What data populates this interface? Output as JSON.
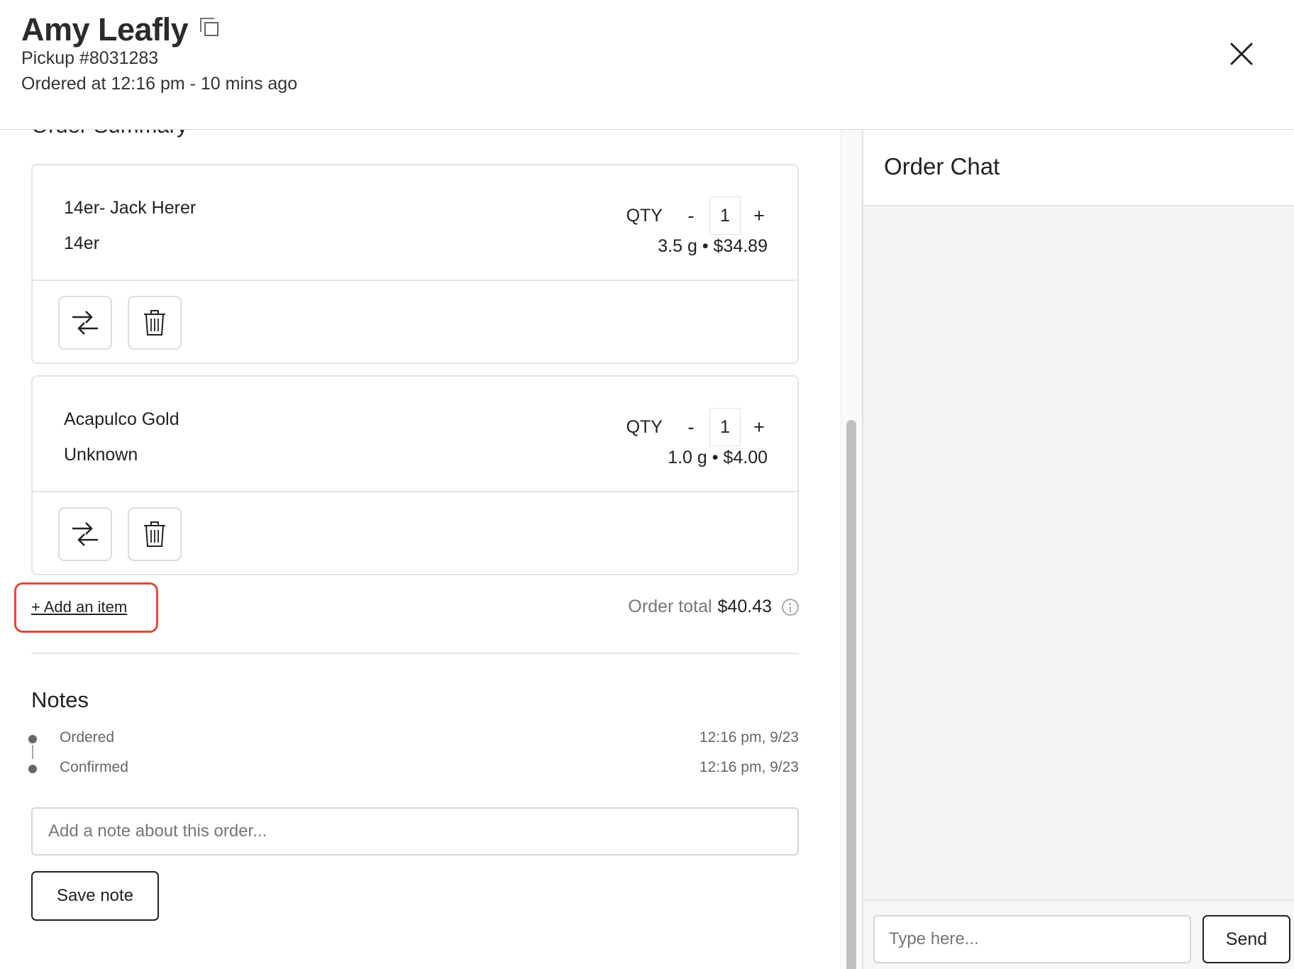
{
  "header": {
    "customer_name": "Amy Leafly",
    "pickup": "Pickup #8031283",
    "ordered_at": "Ordered at 12:16 pm - 10 mins ago"
  },
  "order_summary": {
    "title": "Order Summary",
    "qty_label": "QTY",
    "minus_label": "-",
    "plus_label": "+",
    "items": [
      {
        "name": "14er- Jack Herer",
        "brand": "14er",
        "qty": "1",
        "price_line": "3.5 g • $34.89"
      },
      {
        "name": "Acapulco Gold",
        "brand": "Unknown",
        "qty": "1",
        "price_line": "1.0 g • $4.00"
      }
    ],
    "add_item_label": "+ Add an item",
    "total_label": "Order total",
    "total_value": "$40.43"
  },
  "notes": {
    "title": "Notes",
    "timeline": [
      {
        "label": "Ordered",
        "time": "12:16 pm, 9/23"
      },
      {
        "label": "Confirmed",
        "time": "12:16 pm, 9/23"
      }
    ],
    "input_placeholder": "Add a note about this order...",
    "save_label": "Save note"
  },
  "chat": {
    "title": "Order Chat",
    "input_placeholder": "Type here...",
    "send_label": "Send"
  },
  "colors": {
    "highlight": "#df4b36",
    "border": "#e4e4e4",
    "chat_bg": "#f5f5f5"
  },
  "icons": [
    "copy-icon",
    "close-icon",
    "swap-arrows-icon",
    "trash-icon",
    "info-icon"
  ]
}
